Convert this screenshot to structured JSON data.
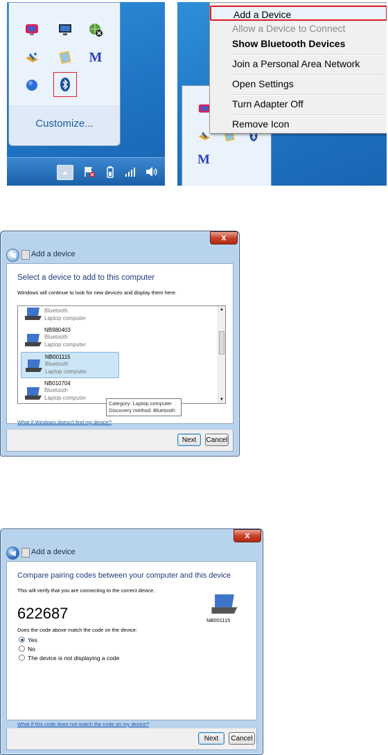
{
  "tray_panel": {
    "icons": [
      "monitor-alert-icon",
      "display-icon",
      "network-x-icon",
      "satellite-icon",
      "notes-icon",
      "m-logo-icon",
      "globe-icon",
      "bluetooth-icon"
    ],
    "m_letter": "M",
    "customize_link": "Customize...",
    "taskbar_icons": [
      "show-hidden-icons-arrow",
      "action-center-flag-icon",
      "battery-icon",
      "signal-icon",
      "volume-icon"
    ]
  },
  "context_menu": {
    "items": [
      {
        "label": "Add a Device",
        "state": "highlighted"
      },
      {
        "label": "Allow a Device to Connect",
        "state": "disabled"
      },
      {
        "label": "Show Bluetooth Devices",
        "state": "bold"
      },
      {
        "label": "Join a Personal Area Network",
        "state": "normal"
      },
      {
        "label": "Open Settings",
        "state": "normal"
      },
      {
        "label": "Turn Adapter Off",
        "state": "normal"
      },
      {
        "label": "Remove Icon",
        "state": "normal"
      }
    ],
    "behind_m_letter": "M"
  },
  "wizard1": {
    "close": "x",
    "nav_title": "Add a device",
    "heading": "Select a device to add to this computer",
    "description": "Windows will continue to look for new devices and display them here.",
    "devices": [
      {
        "name": "",
        "type": "Bluetooth",
        "category": "Laptop computer"
      },
      {
        "name": "NB980403",
        "type": "Bluetooth",
        "category": "Laptop computer"
      },
      {
        "name": "NB001115",
        "type": "Bluetooth",
        "category": "Laptop computer",
        "selected": true
      },
      {
        "name": "NB010704",
        "type": "Bluetooth",
        "category": "Laptop computer"
      }
    ],
    "tooltip": {
      "line1": "Category: Laptop computer",
      "line2": "Discovery method: Bluetooth"
    },
    "help_link": "What if Windows doesn't find my device?",
    "next": "Next",
    "cancel": "Cancel"
  },
  "wizard2": {
    "close": "x",
    "nav_title": "Add a device",
    "heading": "Compare pairing codes between your computer and this device",
    "description": "This will verify that you are connecting to the correct device.",
    "code": "622687",
    "device_name": "NB001115",
    "question": "Does the code above match the code on the device:",
    "options": [
      {
        "label": "Yes",
        "selected": true
      },
      {
        "label": "No",
        "selected": false
      },
      {
        "label": "The device is not displaying a code",
        "selected": false
      }
    ],
    "help_link": "What if this code does not match the code on my device?",
    "next": "Next",
    "cancel": "Cancel"
  },
  "colors": {
    "desktop_blue": "#1f74c4",
    "highlight_red": "#e01c24",
    "link_blue": "#1e5aa8",
    "heading_blue": "#1e3b7b"
  }
}
